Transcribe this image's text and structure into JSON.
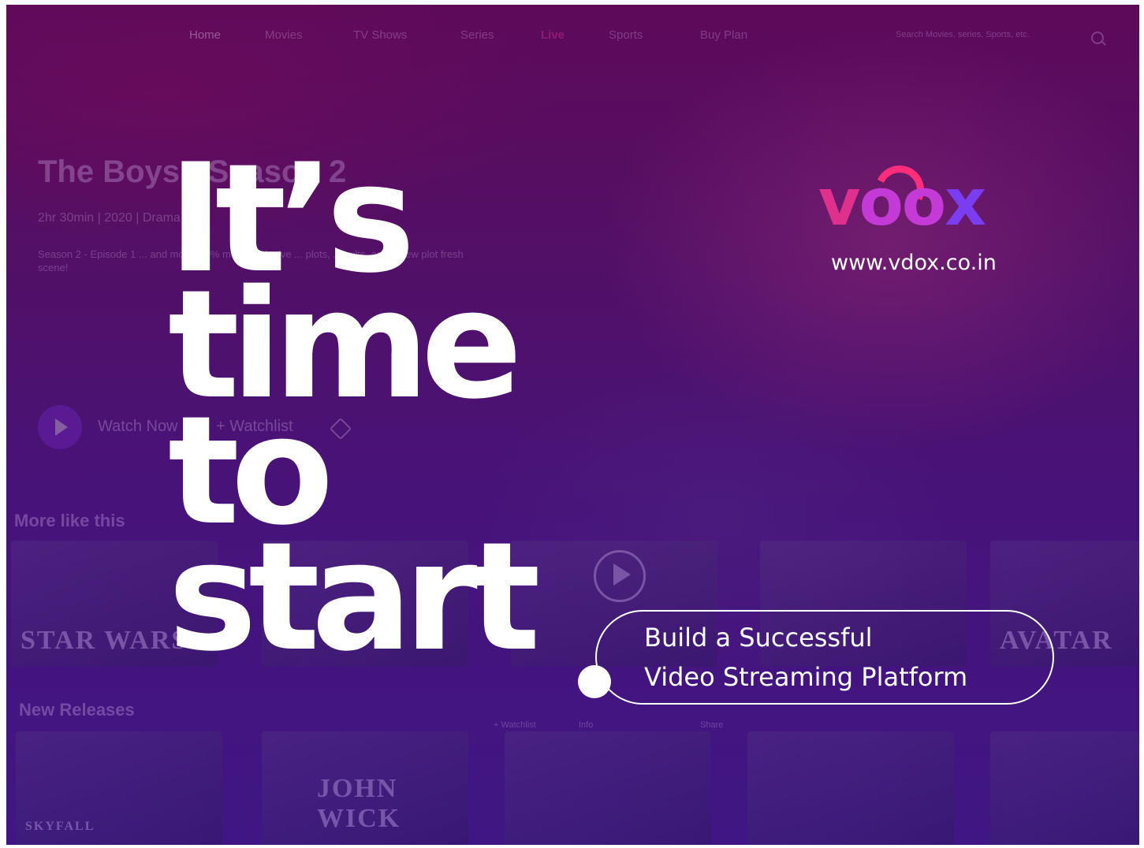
{
  "background_app": {
    "nav": {
      "items": [
        "Home",
        "Movies",
        "TV Shows",
        "Series",
        "Live",
        "Sports",
        "Buy Plan"
      ],
      "search_placeholder": "Search Movies, series, Sports, etc."
    },
    "featured": {
      "title": "The Boys - Season 2",
      "meta": "2hr 30min | 2020 | Drama",
      "description": "Season 2 - Episode 1 ... and more. 50% more explosive ... plots, ... cults, and a new plot fresh scene!",
      "watch_now": "Watch Now",
      "watchlist": "+ Watchlist"
    },
    "rows": {
      "more_like_this": "More like this",
      "new_releases": "New Releases",
      "card_labels": [
        "STAR WARS",
        "AVATAR",
        "JOHN WICK",
        "SKYFALL"
      ],
      "mini_labels": [
        "+ Watchlist",
        "Info",
        "Share"
      ]
    }
  },
  "headline": {
    "line1": "It’s",
    "line2": "time",
    "line3": "to",
    "line4": "start"
  },
  "tagline": {
    "line1": "Build a Successful",
    "line2": "Video Streaming Platform"
  },
  "brand": {
    "logo_text_v": "v",
    "logo_text_o1": "o",
    "logo_text_o2": "o",
    "logo_text_x": "x",
    "url": "www.vdox.co.in",
    "colors": {
      "pink": "#e0308e",
      "purple": "#7a3df0",
      "background": "#4a1278"
    }
  }
}
